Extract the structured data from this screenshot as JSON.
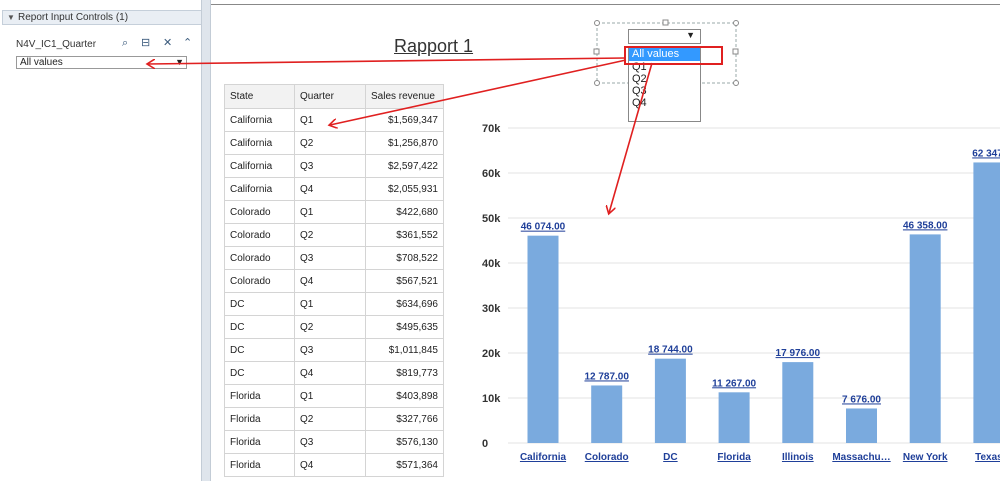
{
  "panel": {
    "title": "Report Input Controls (1)",
    "control_label": "N4V_IC1_Quarter",
    "selected_value": "All values",
    "icons": [
      "search-icon",
      "filter-icon",
      "close-icon",
      "collapse-icon"
    ]
  },
  "report": {
    "title": "Rapport 1"
  },
  "dropdown": {
    "selected": "",
    "options": [
      "All values",
      "Q1",
      "Q2",
      "Q3",
      "Q4"
    ],
    "highlighted": "All values"
  },
  "table": {
    "headers": [
      "State",
      "Quarter",
      "Sales revenue"
    ],
    "rows": [
      [
        "California",
        "Q1",
        "$1,569,347"
      ],
      [
        "California",
        "Q2",
        "$1,256,870"
      ],
      [
        "California",
        "Q3",
        "$2,597,422"
      ],
      [
        "California",
        "Q4",
        "$2,055,931"
      ],
      [
        "Colorado",
        "Q1",
        "$422,680"
      ],
      [
        "Colorado",
        "Q2",
        "$361,552"
      ],
      [
        "Colorado",
        "Q3",
        "$708,522"
      ],
      [
        "Colorado",
        "Q4",
        "$567,521"
      ],
      [
        "DC",
        "Q1",
        "$634,696"
      ],
      [
        "DC",
        "Q2",
        "$495,635"
      ],
      [
        "DC",
        "Q3",
        "$1,011,845"
      ],
      [
        "DC",
        "Q4",
        "$819,773"
      ],
      [
        "Florida",
        "Q1",
        "$403,898"
      ],
      [
        "Florida",
        "Q2",
        "$327,766"
      ],
      [
        "Florida",
        "Q3",
        "$576,130"
      ],
      [
        "Florida",
        "Q4",
        "$571,364"
      ]
    ]
  },
  "chart_data": {
    "type": "bar",
    "categories": [
      "California",
      "Colorado",
      "DC",
      "Florida",
      "Illinois",
      "Massachu…",
      "New York",
      "Texas"
    ],
    "values": [
      46074,
      12787,
      18744,
      11267,
      17976,
      7676,
      46358,
      62347
    ],
    "data_labels": [
      "46 074.00",
      "12 787.00",
      "18 744.00",
      "11 267.00",
      "17 976.00",
      "7 676.00",
      "46 358.00",
      "62 347."
    ],
    "yticks": [
      "0",
      "10k",
      "20k",
      "30k",
      "40k",
      "50k",
      "60k",
      "70k"
    ],
    "ylim": [
      0,
      70000
    ],
    "grid": true,
    "bar_color": "#7aaade",
    "label_color": "#1f3f99"
  },
  "colors": {
    "annotation": "#e02020"
  }
}
